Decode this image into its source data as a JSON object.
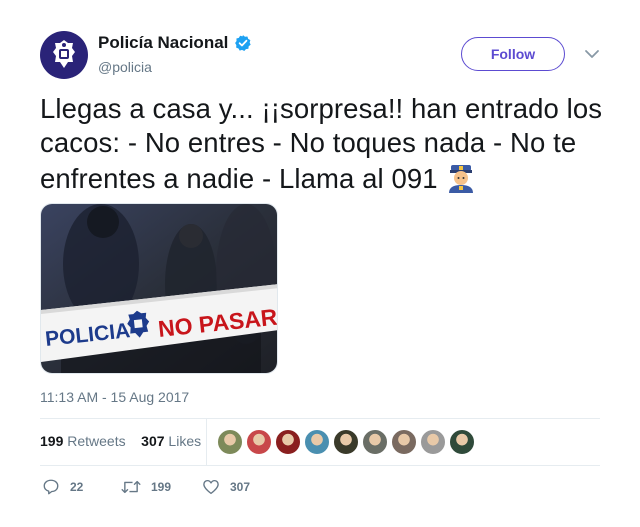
{
  "user": {
    "display_name": "Policía Nacional",
    "handle": "@policia",
    "verified": true,
    "avatar_color": "#2a2378"
  },
  "follow_label": "Follow",
  "tweet": {
    "text": "Llegas a casa y... ¡¡sorpresa!! han entrado los cacos: - No entres - No toques nada - No te enfrentes a nadie - Llama al 091",
    "emoji": "police-officer-emoji",
    "media": {
      "tape_left_text": "POLICIA",
      "tape_right_text": "NO PASAR"
    },
    "timestamp": "11:13 AM - 15 Aug 2017"
  },
  "stats": {
    "retweets_count": "199",
    "retweets_label": "Retweets",
    "likes_count": "307",
    "likes_label": "Likes",
    "liker_avatars": [
      "#7d8a5a",
      "#c8474a",
      "#8a1f1f",
      "#4a8fb0",
      "#3a3a2a",
      "#6a6e66",
      "#7a6a60",
      "#9a9a9a",
      "#2f4a3a"
    ]
  },
  "actions": {
    "reply_count": "22",
    "retweet_count": "199",
    "like_count": "307"
  },
  "colors": {
    "accent": "#5c4bd1",
    "verified": "#1da1f2",
    "muted_text": "#657786"
  }
}
